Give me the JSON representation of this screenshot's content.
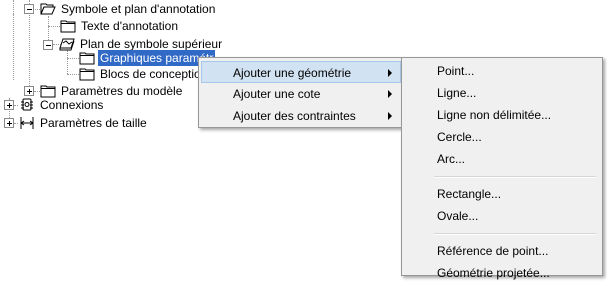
{
  "tree": {
    "items": [
      {
        "label": "Symbole et plan d'annotation"
      },
      {
        "label": "Texte d'annotation"
      },
      {
        "label": "Plan de symbole supérieur"
      },
      {
        "label": "Graphiques paramétr"
      },
      {
        "label": "Blocs de conception"
      },
      {
        "label": "Paramètres du modèle"
      },
      {
        "label": "Connexions"
      },
      {
        "label": "Paramètres de taille"
      }
    ]
  },
  "context_menu": {
    "items": [
      {
        "label": "Ajouter une géométrie"
      },
      {
        "label": "Ajouter une cote"
      },
      {
        "label": "Ajouter des contraintes"
      }
    ]
  },
  "submenu": {
    "items": [
      {
        "label": "Point..."
      },
      {
        "label": "Ligne..."
      },
      {
        "label": "Ligne non délimitée..."
      },
      {
        "label": "Cercle..."
      },
      {
        "label": "Arc..."
      },
      {
        "label": "Rectangle..."
      },
      {
        "label": "Ovale..."
      },
      {
        "label": "Référence de point..."
      },
      {
        "label": "Géométrie projetée..."
      }
    ]
  },
  "colors": {
    "selection": "#3169c6",
    "menu_background": "#f0f0f0",
    "menu_hover": "#d1e2f2"
  },
  "icons": [
    "open-folder-icon",
    "folder-icon",
    "plan-icon",
    "connections-icon",
    "size-parameters-icon"
  ]
}
